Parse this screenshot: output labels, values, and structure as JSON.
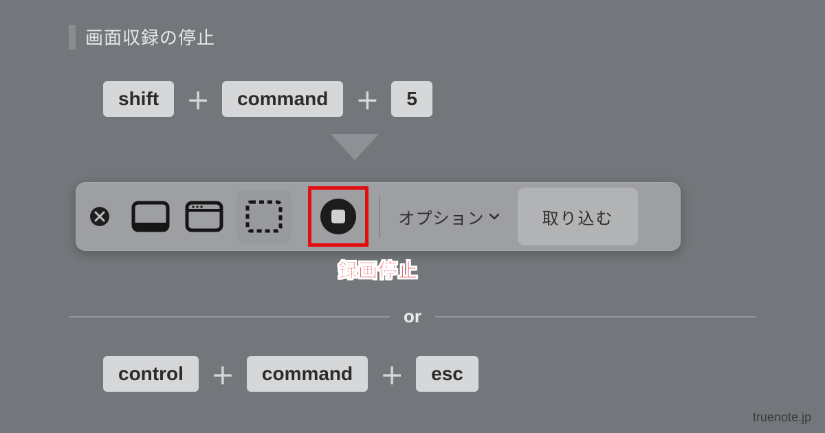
{
  "title": "画面収録の停止",
  "shortcut1": {
    "key1": "shift",
    "key2": "command",
    "key3": "5"
  },
  "shortcut2": {
    "key1": "control",
    "key2": "command",
    "key3": "esc"
  },
  "toolbar": {
    "options_label": "オプション",
    "capture_label": "取り込む"
  },
  "stop_label": "録画停止",
  "or_label": "or",
  "plus": "＋",
  "watermark": "truenote.jp"
}
